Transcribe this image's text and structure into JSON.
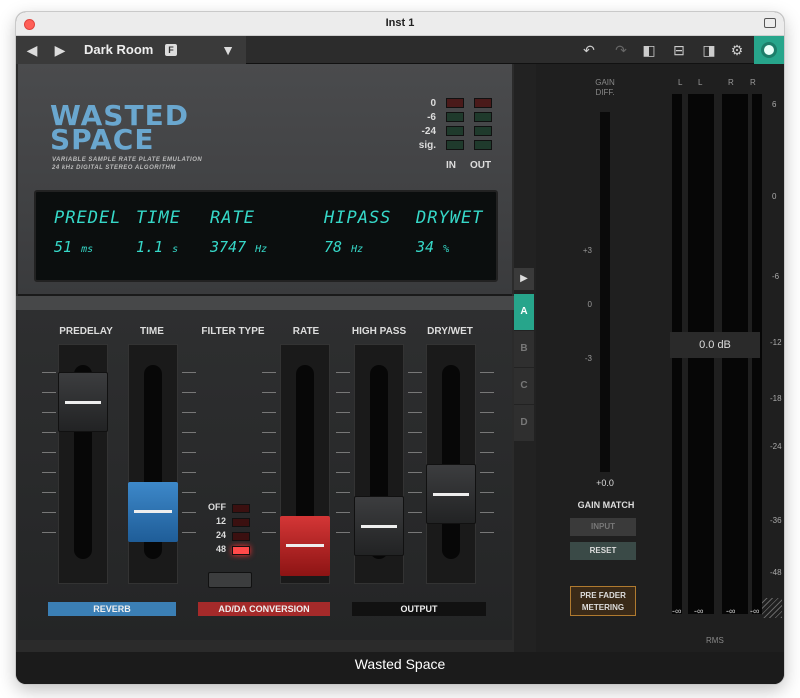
{
  "window": {
    "title": "Inst 1"
  },
  "toolbar": {
    "preset_name": "Dark Room",
    "preset_badge": "F"
  },
  "plugin": {
    "logo_line1": "WASTED",
    "logo_line2": "SPACE",
    "subtitle_line1": "VARIABLE SAMPLE RATE PLATE EMULATION",
    "subtitle_line2": "24 kHz DIGITAL STEREO ALGORITHM",
    "meter_labels": [
      "0",
      "-6",
      "-24",
      "sig."
    ],
    "in_label": "IN",
    "out_label": "OUT",
    "display": {
      "headers": [
        "PREDEL",
        "TIME",
        "RATE",
        "HIPASS",
        "DRYWET"
      ],
      "values": [
        "51",
        "1.1",
        "3747",
        "78",
        "34"
      ],
      "units": [
        "ms",
        "s",
        "Hz",
        "Hz",
        "%"
      ]
    },
    "columns": [
      "PREDELAY",
      "TIME",
      "FILTER TYPE",
      "RATE",
      "HIGH PASS",
      "DRY/WET"
    ],
    "filter_options": [
      "OFF",
      "12",
      "24",
      "48"
    ],
    "filter_selected": "48",
    "sections": {
      "reverb": "REVERB",
      "adda": "AD/DA CONVERSION",
      "output": "OUTPUT"
    }
  },
  "snapshots": [
    "A",
    "B",
    "C",
    "D"
  ],
  "snapshot_selected": "A",
  "gain": {
    "label_line1": "GAIN",
    "label_line2": "DIFF.",
    "scale": [
      "+3",
      "0",
      "-3"
    ],
    "value": "+0.0",
    "match_label": "GAIN MATCH",
    "input_label": "INPUT",
    "reset_label": "RESET",
    "prefader_line1": "PRE FADER",
    "prefader_line2": "METERING"
  },
  "meters": {
    "channels": [
      "L",
      "L",
      "R",
      "R"
    ],
    "scale": [
      "6",
      "0",
      "-6",
      "-12",
      "-18",
      "-24",
      "-36",
      "-48"
    ],
    "readout": "0.0 dB",
    "inf": "-∞",
    "rms_label": "RMS"
  },
  "footer": {
    "title": "Wasted Space"
  }
}
